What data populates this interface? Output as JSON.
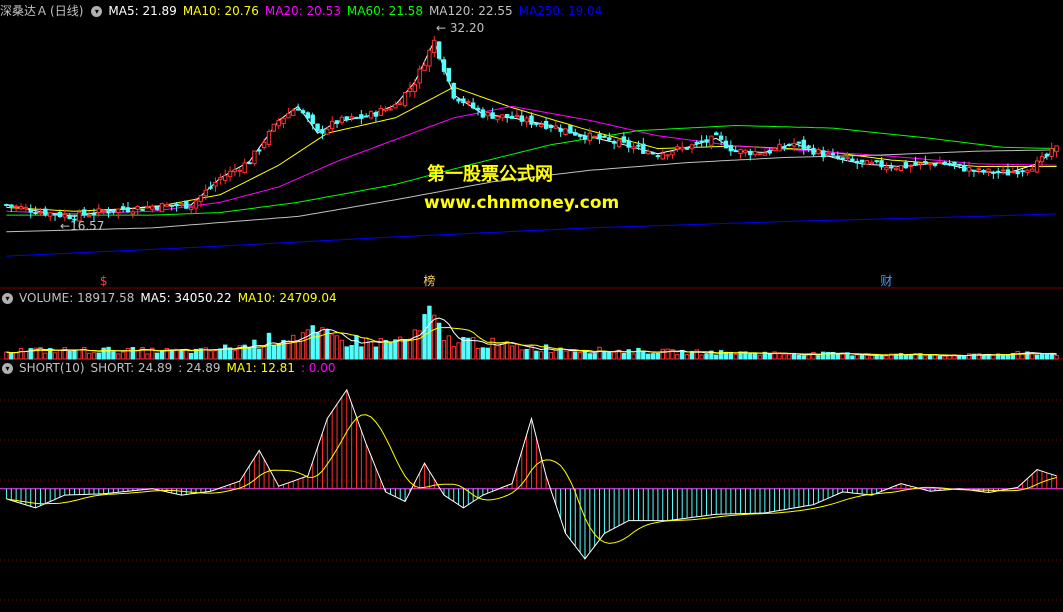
{
  "header": {
    "stock": "深桑达Ａ",
    "period": "(日线)",
    "ma": [
      {
        "label": "MA5: 21.89",
        "color": "#ffffff"
      },
      {
        "label": "MA10: 20.76",
        "color": "#ffff00"
      },
      {
        "label": "MA20: 20.53",
        "color": "#ff00ff"
      },
      {
        "label": "MA60: 21.58",
        "color": "#00ff00"
      },
      {
        "label": "MA120: 22.55",
        "color": "#c0c0c0"
      },
      {
        "label": "MA250: 19.04",
        "color": "#0000ff"
      }
    ]
  },
  "volume_header": [
    {
      "label": "VOLUME: 18917.58",
      "color": "#c0c0c0"
    },
    {
      "label": "MA5: 34050.22",
      "color": "#ffffff"
    },
    {
      "label": "MA10: 24709.04",
      "color": "#ffff00"
    }
  ],
  "short_header": [
    {
      "label": "SHORT(10)",
      "color": "#c0c0c0"
    },
    {
      "label": "SHORT: 24.89",
      "color": "#c0c0c0"
    },
    {
      "label": ": 24.89",
      "color": "#c0c0c0"
    },
    {
      "label": "MA1: 12.81",
      "color": "#ffff00"
    },
    {
      "label": ": 0.00",
      "color": "#ff00ff"
    }
  ],
  "watermark": {
    "line1": "第一股票公式网",
    "line2": "www.chnmoney.com"
  },
  "price_annotations": {
    "high": "32.20",
    "low": "16.57"
  },
  "event_marks": [
    {
      "text": "$",
      "color": "#ff4040",
      "day": 20
    },
    {
      "text": "榜",
      "color": "#ffd060",
      "day": 87
    },
    {
      "text": "财",
      "color": "#40a0ff",
      "day": 181
    }
  ],
  "colors": {
    "up": "#ff3030",
    "down": "#54ffff",
    "grid": "#800000",
    "ma5": "#ffffff",
    "ma10": "#ffff00",
    "ma20": "#ff00ff",
    "ma60": "#00ff00",
    "ma120": "#c0c0c0",
    "ma250": "#0000ff"
  },
  "chart_data": {
    "type": "candlestick",
    "close_keypoints": [
      [
        0,
        19.4
      ],
      [
        8,
        18.8
      ],
      [
        14,
        18.5
      ],
      [
        20,
        18.9
      ],
      [
        30,
        19.3
      ],
      [
        38,
        19.4
      ],
      [
        44,
        21.5
      ],
      [
        50,
        22.8
      ],
      [
        56,
        26.0
      ],
      [
        60,
        27.1
      ],
      [
        64,
        25.0
      ],
      [
        68,
        25.9
      ],
      [
        74,
        26.3
      ],
      [
        80,
        27.2
      ],
      [
        84,
        29.0
      ],
      [
        88,
        32.2
      ],
      [
        92,
        28.0
      ],
      [
        98,
        26.5
      ],
      [
        104,
        26.2
      ],
      [
        112,
        25.6
      ],
      [
        118,
        24.9
      ],
      [
        126,
        24.2
      ],
      [
        134,
        23.4
      ],
      [
        140,
        23.9
      ],
      [
        146,
        24.6
      ],
      [
        150,
        23.6
      ],
      [
        156,
        23.5
      ],
      [
        162,
        24.2
      ],
      [
        170,
        23.1
      ],
      [
        176,
        22.6
      ],
      [
        184,
        22.4
      ],
      [
        192,
        22.7
      ],
      [
        200,
        22.0
      ],
      [
        206,
        21.9
      ],
      [
        212,
        22.6
      ],
      [
        216,
        23.8
      ]
    ],
    "ma_keypoints": {
      "MA10": [
        [
          0,
          19.2
        ],
        [
          14,
          18.9
        ],
        [
          30,
          19.2
        ],
        [
          44,
          20.2
        ],
        [
          56,
          22.5
        ],
        [
          66,
          25.0
        ],
        [
          80,
          26.2
        ],
        [
          92,
          28.6
        ],
        [
          104,
          27.0
        ],
        [
          120,
          25.2
        ],
        [
          134,
          23.8
        ],
        [
          150,
          24.0
        ],
        [
          166,
          23.7
        ],
        [
          182,
          22.9
        ],
        [
          200,
          22.4
        ],
        [
          216,
          22.4
        ]
      ],
      "MA20": [
        [
          0,
          18.9
        ],
        [
          14,
          18.7
        ],
        [
          30,
          18.9
        ],
        [
          44,
          19.6
        ],
        [
          56,
          20.8
        ],
        [
          68,
          22.8
        ],
        [
          80,
          24.5
        ],
        [
          92,
          26.2
        ],
        [
          104,
          27.1
        ],
        [
          120,
          26.0
        ],
        [
          134,
          24.8
        ],
        [
          150,
          24.0
        ],
        [
          166,
          23.6
        ],
        [
          182,
          23.2
        ],
        [
          200,
          22.6
        ],
        [
          216,
          22.5
        ]
      ],
      "MA60": [
        [
          0,
          18.6
        ],
        [
          30,
          18.6
        ],
        [
          44,
          18.8
        ],
        [
          60,
          19.6
        ],
        [
          80,
          21.0
        ],
        [
          96,
          22.6
        ],
        [
          112,
          24.1
        ],
        [
          130,
          25.2
        ],
        [
          150,
          25.6
        ],
        [
          170,
          25.4
        ],
        [
          190,
          24.6
        ],
        [
          205,
          23.9
        ],
        [
          216,
          23.8
        ]
      ],
      "MA120": [
        [
          0,
          17.3
        ],
        [
          30,
          17.6
        ],
        [
          60,
          18.5
        ],
        [
          80,
          19.8
        ],
        [
          100,
          21.2
        ],
        [
          120,
          22.1
        ],
        [
          140,
          22.7
        ],
        [
          160,
          23.1
        ],
        [
          180,
          23.3
        ],
        [
          200,
          23.6
        ],
        [
          216,
          23.7
        ]
      ],
      "MA250": [
        [
          0,
          15.4
        ],
        [
          40,
          16.1
        ],
        [
          80,
          16.9
        ],
        [
          120,
          17.6
        ],
        [
          160,
          18.1
        ],
        [
          200,
          18.5
        ],
        [
          216,
          18.7
        ]
      ]
    },
    "volume_keypoints": [
      [
        0,
        9000
      ],
      [
        20,
        9000
      ],
      [
        40,
        8000
      ],
      [
        50,
        14000
      ],
      [
        56,
        22000
      ],
      [
        62,
        26000
      ],
      [
        70,
        19000
      ],
      [
        78,
        17000
      ],
      [
        84,
        22000
      ],
      [
        87,
        45000
      ],
      [
        90,
        20000
      ],
      [
        96,
        18000
      ],
      [
        104,
        13000
      ],
      [
        120,
        9000
      ],
      [
        140,
        7000
      ],
      [
        170,
        5000
      ],
      [
        200,
        4000
      ],
      [
        210,
        6000
      ],
      [
        216,
        5000
      ]
    ],
    "short_keypoints": [
      [
        0,
        -16
      ],
      [
        6,
        -30
      ],
      [
        12,
        -10
      ],
      [
        20,
        -8
      ],
      [
        30,
        0
      ],
      [
        36,
        -10
      ],
      [
        42,
        -4
      ],
      [
        48,
        12
      ],
      [
        52,
        60
      ],
      [
        56,
        4
      ],
      [
        62,
        20
      ],
      [
        66,
        110
      ],
      [
        70,
        155
      ],
      [
        74,
        70
      ],
      [
        78,
        -5
      ],
      [
        82,
        -20
      ],
      [
        86,
        40
      ],
      [
        90,
        -10
      ],
      [
        94,
        -30
      ],
      [
        98,
        -10
      ],
      [
        104,
        8
      ],
      [
        108,
        110
      ],
      [
        111,
        20
      ],
      [
        115,
        -70
      ],
      [
        119,
        -110
      ],
      [
        123,
        -70
      ],
      [
        128,
        -50
      ],
      [
        136,
        -50
      ],
      [
        146,
        -40
      ],
      [
        156,
        -38
      ],
      [
        166,
        -25
      ],
      [
        172,
        -5
      ],
      [
        178,
        -10
      ],
      [
        184,
        8
      ],
      [
        190,
        -4
      ],
      [
        196,
        0
      ],
      [
        202,
        -6
      ],
      [
        208,
        2
      ],
      [
        212,
        30
      ],
      [
        216,
        20
      ]
    ],
    "panels": {
      "price": {
        "ylim": [
          14.0,
          34.0
        ]
      },
      "volume": {
        "ylim": [
          0,
          55000
        ]
      },
      "short": {
        "ylim": [
          -190,
          175
        ]
      }
    },
    "num_days": 217
  }
}
